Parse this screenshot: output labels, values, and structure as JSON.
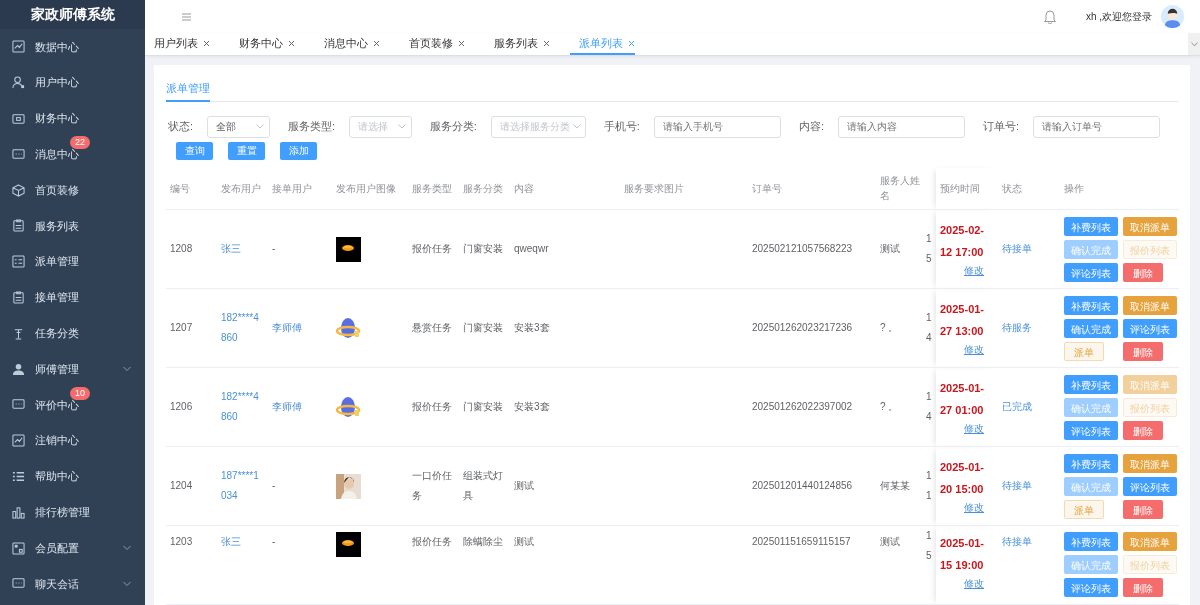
{
  "sidebar": {
    "title": "家政师傅系统",
    "items": [
      {
        "label": "数据中心",
        "expandable": false
      },
      {
        "label": "用户中心",
        "expandable": false
      },
      {
        "label": "财务中心",
        "expandable": false
      },
      {
        "label": "消息中心",
        "badge": "22",
        "expandable": false
      },
      {
        "label": "首页装修",
        "expandable": false
      },
      {
        "label": "服务列表",
        "expandable": false
      },
      {
        "label": "派单管理",
        "expandable": false
      },
      {
        "label": "接单管理",
        "expandable": false
      },
      {
        "label": "任务分类",
        "expandable": false
      },
      {
        "label": "师傅管理",
        "expandable": true
      },
      {
        "label": "评价中心",
        "badge": "10",
        "expandable": false
      },
      {
        "label": "注销中心",
        "expandable": false
      },
      {
        "label": "帮助中心",
        "expandable": false
      },
      {
        "label": "排行榜管理",
        "expandable": false
      },
      {
        "label": "会员配置",
        "expandable": true
      },
      {
        "label": "聊天会话",
        "expandable": true
      }
    ]
  },
  "header": {
    "greeting": "xh ,欢迎您登录"
  },
  "tabs": [
    {
      "label": "用户列表",
      "selected": false
    },
    {
      "label": "财务中心",
      "selected": false
    },
    {
      "label": "消息中心",
      "selected": false
    },
    {
      "label": "首页装修",
      "selected": false
    },
    {
      "label": "服务列表",
      "selected": false
    },
    {
      "label": "派单列表",
      "selected": true
    }
  ],
  "section_tab": "派单管理",
  "filters": [
    {
      "label": "状态:",
      "kind": "select",
      "value": "全部"
    },
    {
      "label": "服务类型:",
      "kind": "select",
      "placeholder": "请选择"
    },
    {
      "label": "服务分类:",
      "kind": "select",
      "placeholder": "请选择服务分类"
    },
    {
      "label": "手机号:",
      "kind": "input",
      "placeholder": "请输入手机号"
    },
    {
      "label": "内容:",
      "kind": "input",
      "placeholder": "请输入内容"
    },
    {
      "label": "订单号:",
      "kind": "input",
      "placeholder": "请输入订单号"
    }
  ],
  "buttons": [
    "查询",
    "重置",
    "添加"
  ],
  "table": {
    "columns": [
      "编号",
      "发布用户",
      "接单用户",
      "发布用户图像",
      "服务类型",
      "服务分类",
      "内容",
      "服务要求图片",
      "订单号",
      "服务人姓名",
      "",
      "预约时间",
      "状态",
      "操作"
    ],
    "rows": [
      {
        "id": "1208",
        "publisher": "张三",
        "taker": "-",
        "taker_link": false,
        "service_type": "报价任务",
        "category": "门窗安装",
        "content": "qweqwr",
        "order_no": "202502121057568223",
        "worker": "测试",
        "column_11": "15",
        "date": "2025-02-12 17:00",
        "edit": "修改",
        "status": "待接单",
        "actions": [
          {
            "label": "补费列表",
            "kind": "primary",
            "disabled": false
          },
          {
            "label": "取消派单",
            "kind": "warning",
            "disabled": false
          },
          {
            "label": "确认完成",
            "kind": "primary",
            "disabled": true
          },
          {
            "label": "报价列表",
            "kind": "plain",
            "disabled": true
          },
          {
            "label": "评论列表",
            "kind": "primary",
            "disabled": false
          },
          {
            "label": "删除",
            "kind": "danger",
            "disabled": false
          }
        ]
      },
      {
        "id": "1207",
        "publisher": "182****4860",
        "taker": "李师傅",
        "taker_link": true,
        "service_type": "悬赏任务",
        "category": "门窗安装",
        "content": "安装3套",
        "order_no": "202501262023217236",
        "worker": "? 。",
        "column_11": "14",
        "date": "2025-01-27 13:00",
        "edit": "修改",
        "status": "待服务",
        "actions": [
          {
            "label": "补费列表",
            "kind": "primary",
            "disabled": false
          },
          {
            "label": "取消派单",
            "kind": "warning",
            "disabled": false
          },
          {
            "label": "确认完成",
            "kind": "primary",
            "disabled": false
          },
          {
            "label": "评论列表",
            "kind": "primary",
            "disabled": false
          },
          {
            "label": "派单",
            "kind": "plain",
            "disabled": false
          },
          {
            "label": "删除",
            "kind": "danger",
            "disabled": false
          }
        ]
      },
      {
        "id": "1206",
        "publisher": "182****4860",
        "taker": "李师傅",
        "taker_link": true,
        "service_type": "报价任务",
        "category": "门窗安装",
        "content": "安装3套",
        "order_no": "202501262022397002",
        "worker": "? 。",
        "column_11": "14",
        "date": "2025-01-27 01:00",
        "edit": "修改",
        "status": "已完成",
        "actions": [
          {
            "label": "补费列表",
            "kind": "primary",
            "disabled": false
          },
          {
            "label": "取消派单",
            "kind": "warning",
            "disabled": true
          },
          {
            "label": "确认完成",
            "kind": "primary",
            "disabled": true
          },
          {
            "label": "报价列表",
            "kind": "plain",
            "disabled": true
          },
          {
            "label": "评论列表",
            "kind": "primary",
            "disabled": false
          },
          {
            "label": "删除",
            "kind": "danger",
            "disabled": false
          }
        ]
      },
      {
        "id": "1204",
        "publisher": "187****1034",
        "taker": "-",
        "taker_link": false,
        "service_type": "一口价任务",
        "category": "组装式灯具",
        "content": "测试",
        "order_no": "202501201440124856",
        "worker": "何某某",
        "column_11": "11",
        "date": "2025-01-20 15:00",
        "edit": "修改",
        "status": "待接单",
        "actions": [
          {
            "label": "补费列表",
            "kind": "primary",
            "disabled": false
          },
          {
            "label": "取消派单",
            "kind": "warning",
            "disabled": false
          },
          {
            "label": "确认完成",
            "kind": "primary",
            "disabled": true
          },
          {
            "label": "评论列表",
            "kind": "primary",
            "disabled": false
          },
          {
            "label": "派单",
            "kind": "plain",
            "disabled": false
          },
          {
            "label": "删除",
            "kind": "danger",
            "disabled": false
          }
        ]
      },
      {
        "id": "1203",
        "publisher": "张三",
        "taker": "-",
        "taker_link": false,
        "service_type": "报价任务",
        "category": "除螨除尘",
        "content": "测试",
        "order_no": "202501151659115157",
        "worker": "测试",
        "column_11": "15",
        "date": "2025-01-15 19:00",
        "edit": "修改",
        "status": "待接单",
        "actions": [
          {
            "label": "补费列表",
            "kind": "primary",
            "disabled": false
          },
          {
            "label": "取消派单",
            "kind": "warning",
            "disabled": false
          },
          {
            "label": "确认完成",
            "kind": "primary",
            "disabled": true
          },
          {
            "label": "报价列表",
            "kind": "plain",
            "disabled": true
          },
          {
            "label": "评论列表",
            "kind": "primary",
            "disabled": false
          },
          {
            "label": "删除",
            "kind": "danger",
            "disabled": false
          }
        ]
      }
    ]
  }
}
